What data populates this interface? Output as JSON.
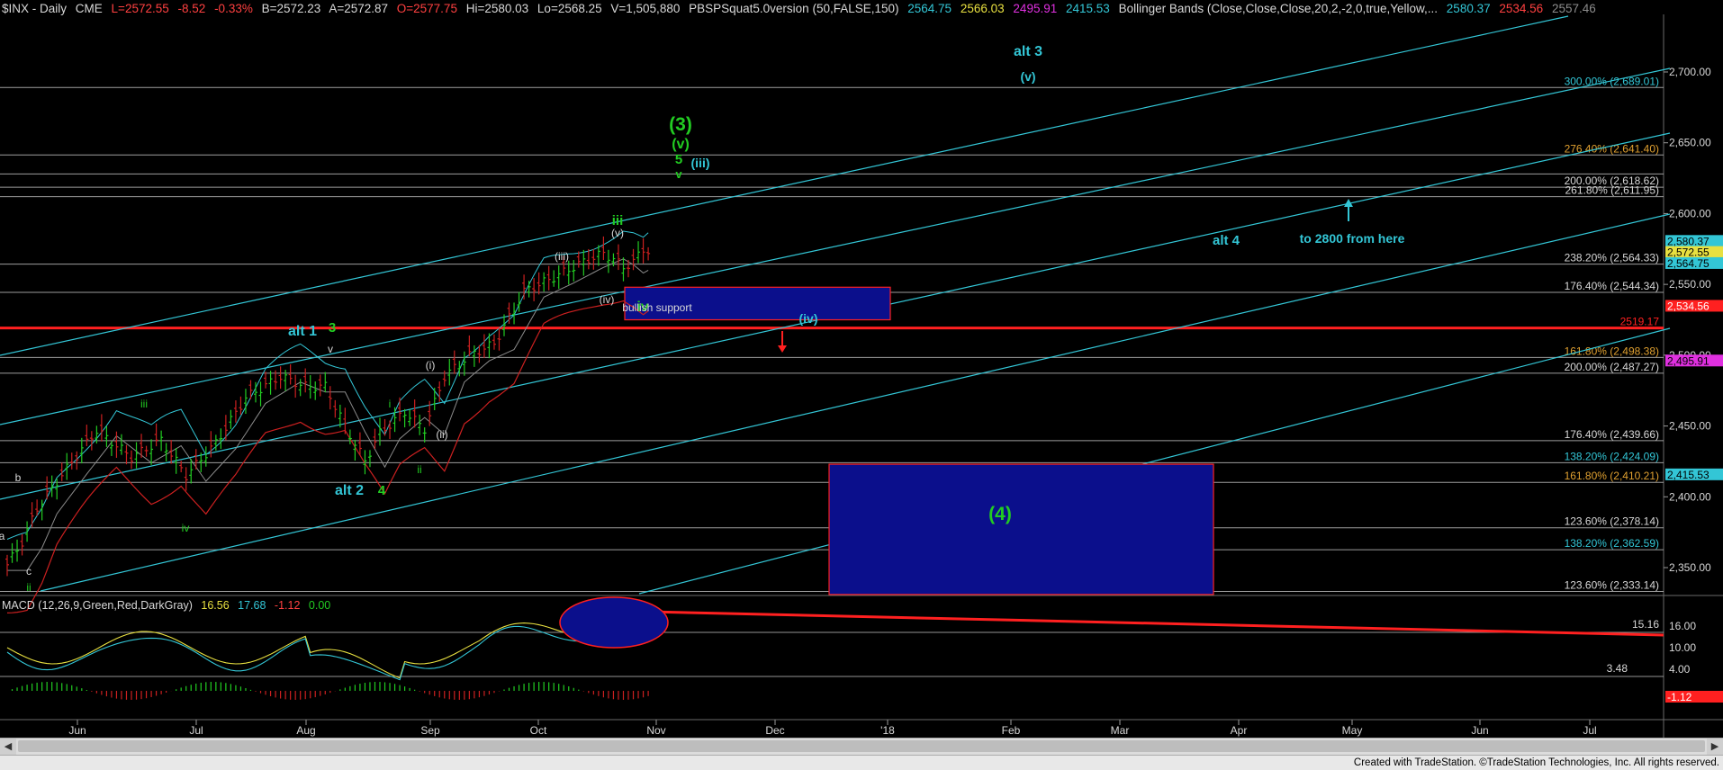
{
  "header": {
    "symbol": "$INX - Daily",
    "exchange": "CME",
    "last": "L=2572.55",
    "chg": "-8.52",
    "pct": "-0.33%",
    "bid": "B=2572.23",
    "ask": "A=2572.87",
    "open": "O=2577.75",
    "hi": "Hi=2580.03",
    "lo": "Lo=2568.25",
    "vol": "V=1,505,880",
    "study1": "PBSPSquat5.0version (50,FALSE,150)",
    "s1v1": "2564.75",
    "s1v2": "2566.03",
    "s1v3": "2495.91",
    "s1v4": "2415.53",
    "bb": "Bollinger Bands (Close,Close,Close,20,2,-2,0,true,Yellow,...",
    "bbv1": "2580.37",
    "bbv2": "2534.56",
    "bbv3": "2557.46"
  },
  "macd_header": {
    "label": "MACD (12,26,9,Green,Red,DarkGray)",
    "v1": "16.56",
    "v2": "17.68",
    "v3": "-1.12",
    "v4": "0.00"
  },
  "footer": {
    "text": "Created with TradeStation. ©TradeStation Technologies, Inc. All rights reserved."
  },
  "colors": {
    "bg": "#000000",
    "green": "#22cc22",
    "cyan": "#33c6d6",
    "red": "#ff2020",
    "white": "#d8d8d8",
    "fib": "#bcbcbc",
    "navy": "#0b0f8c",
    "yellow": "#e8e040",
    "orange": "#e0a030"
  },
  "chart_data": {
    "type": "candlestick",
    "symbol": "$INX",
    "interval": "Daily",
    "ylim": [
      2310,
      2740
    ],
    "x_tick_labels": [
      "Jun",
      "Jul",
      "Aug",
      "Sep",
      "Oct",
      "Nov",
      "Dec",
      "'18",
      "Feb",
      "Mar",
      "Apr",
      "May",
      "Jun",
      "Jul"
    ],
    "y_tick_labels": [
      "2,700.00",
      "2,650.00",
      "2,600.00",
      "2,550.00",
      "2,500.00",
      "2,450.00",
      "2,400.00",
      "2,350.00"
    ],
    "y_ticks": [
      2700,
      2650,
      2600,
      2550,
      2500,
      2450,
      2400,
      2350
    ],
    "price_markers": [
      {
        "label": "2,580.37",
        "value": 2580.37,
        "color": "#33c6d6"
      },
      {
        "label": "2,572.55",
        "value": 2572.55,
        "color": "#e8e040"
      },
      {
        "label": "2,564.75",
        "value": 2564.75,
        "color": "#33c6d6"
      },
      {
        "label": "2,534.56",
        "value": 2534.56,
        "color": "#ff2020"
      },
      {
        "label": "2,495.91",
        "value": 2495.91,
        "color": "#e030e0"
      },
      {
        "label": "2,415.53",
        "value": 2415.53,
        "color": "#33c6d6"
      }
    ],
    "fib_levels": [
      {
        "label": "300.00% (2,689.01)",
        "value": 2689.01,
        "color": "#33c6d6"
      },
      {
        "label": "276.40% (2,641.40)",
        "value": 2641.4,
        "color": "#e0a030"
      },
      {
        "label": "200.00% (2,618.62)",
        "value": 2618.62,
        "color": "#d8d8d8"
      },
      {
        "label": "261.80% (2,611.95)",
        "value": 2611.95,
        "color": "#d8d8d8"
      },
      {
        "label": "238.20% (2,564.33)",
        "value": 2564.33,
        "color": "#d8d8d8"
      },
      {
        "label": "176.40% (2,544.34)",
        "value": 2544.34,
        "color": "#d8d8d8"
      },
      {
        "label": "2519.17",
        "value": 2519.17,
        "color": "#ff2020"
      },
      {
        "label": "161.80% (2,498.38)",
        "value": 2498.38,
        "color": "#e0a030"
      },
      {
        "label": "200.00% (2,487.27)",
        "value": 2487.27,
        "color": "#d8d8d8"
      },
      {
        "label": "176.40% (2,439.66)",
        "value": 2439.66,
        "color": "#d8d8d8"
      },
      {
        "label": "138.20% (2,424.09)",
        "value": 2424.09,
        "color": "#33c6d6"
      },
      {
        "label": "161.80% (2,410.21)",
        "value": 2410.21,
        "color": "#e0a030"
      },
      {
        "label": "123.60% (2,378.14)",
        "value": 2378.14,
        "color": "#d8d8d8"
      },
      {
        "label": "138.20% (2,362.59)",
        "value": 2362.59,
        "color": "#33c6d6"
      },
      {
        "label": "123.60% (2,333.14)",
        "value": 2333.14,
        "color": "#d8d8d8"
      }
    ],
    "annotations": [
      {
        "text": "alt 3",
        "color": "#33c6d6"
      },
      {
        "text": "(v)",
        "color": "#33c6d6"
      },
      {
        "text": "(3)",
        "color": "#22cc22"
      },
      {
        "text": "(v)",
        "color": "#22cc22"
      },
      {
        "text": "5",
        "color": "#22cc22"
      },
      {
        "text": "v",
        "color": "#22cc22"
      },
      {
        "text": "(iii)",
        "color": "#33c6d6"
      },
      {
        "text": "iii",
        "color": "#22cc22"
      },
      {
        "text": "(v)",
        "color": "#d8d8d8"
      },
      {
        "text": "(iii)",
        "color": "#d8d8d8"
      },
      {
        "text": "(iv)",
        "color": "#d8d8d8"
      },
      {
        "text": "iv",
        "color": "#22cc22"
      },
      {
        "text": "bullish support",
        "color": "#d8d8d8"
      },
      {
        "text": "(iv)",
        "color": "#33c6d6"
      },
      {
        "text": "alt 4",
        "color": "#33c6d6"
      },
      {
        "text": "to 2800 from here",
        "color": "#33c6d6"
      },
      {
        "text": "alt 1",
        "color": "#33c6d6"
      },
      {
        "text": "3",
        "color": "#22cc22"
      },
      {
        "text": "v",
        "color": "#d8d8d8"
      },
      {
        "text": "(i)",
        "color": "#d8d8d8"
      },
      {
        "text": "iii",
        "color": "#22cc22"
      },
      {
        "text": "i",
        "color": "#22cc22"
      },
      {
        "text": "(ii)",
        "color": "#d8d8d8"
      },
      {
        "text": "ii",
        "color": "#22cc22"
      },
      {
        "text": "iv",
        "color": "#22cc22"
      },
      {
        "text": "alt 2",
        "color": "#33c6d6"
      },
      {
        "text": "4",
        "color": "#22cc22"
      },
      {
        "text": "b",
        "color": "#d8d8d8"
      },
      {
        "text": "a",
        "color": "#d8d8d8"
      },
      {
        "text": "c",
        "color": "#d8d8d8"
      },
      {
        "text": "ii",
        "color": "#22cc22"
      },
      {
        "text": "(4)",
        "color": "#22cc22"
      }
    ],
    "zones": [
      {
        "name": "bullish support",
        "low": 2525,
        "high": 2548
      },
      {
        "name": "wave (4) target",
        "low": 2331,
        "high": 2423
      }
    ],
    "macd": {
      "label": "MACD (12,26,9,Green,Red,DarkGray)",
      "macd": 16.56,
      "signal": 17.68,
      "diff": -1.12,
      "zero": 0.0,
      "y_tick_labels": [
        "16.00",
        "10.00",
        "4.00"
      ],
      "level_labels": [
        {
          "label": "15.16",
          "color": "#d8d8d8"
        },
        {
          "label": "3.48",
          "color": "#d8d8d8"
        },
        {
          "label": "-1.12",
          "color": "#ff2020"
        }
      ]
    }
  }
}
